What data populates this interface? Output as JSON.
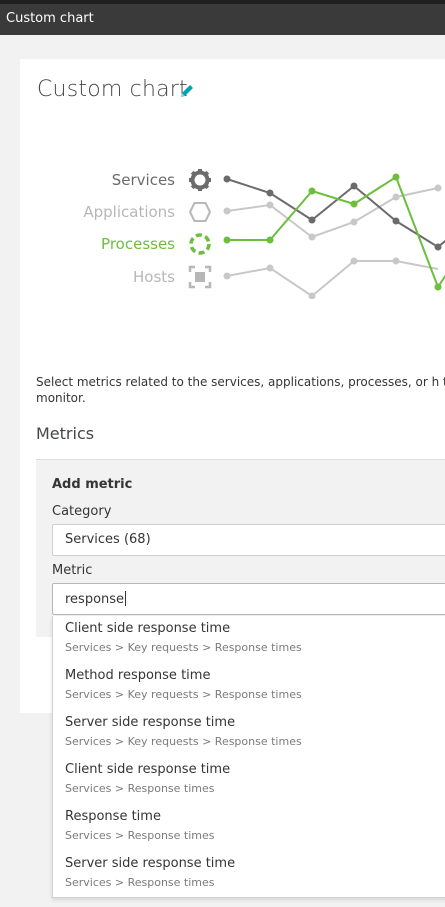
{
  "window": {
    "title": "Custom chart"
  },
  "page": {
    "title": "Custom chart"
  },
  "legend": [
    {
      "label": "Services",
      "color": "#6b6b6b",
      "icon": "gear-icon"
    },
    {
      "label": "Applications",
      "color": "#b7b7b7",
      "icon": "hexagon-icon"
    },
    {
      "label": "Processes",
      "color": "#6bbf3c",
      "icon": "dashed-circle-icon"
    },
    {
      "label": "Hosts",
      "color": "#b7b7b7",
      "icon": "host-square-icon"
    }
  ],
  "description": "Select metrics related to the services, applications, processes, or h to monitor.",
  "metrics_section": {
    "title": "Metrics",
    "add_metric": "Add metric",
    "category_label": "Category",
    "category_value": "Services (68)",
    "metric_label": "Metric",
    "metric_value": "response"
  },
  "suggestions": [
    {
      "name": "Client side response time",
      "path": "Services > Key requests > Response times"
    },
    {
      "name": "Method response time",
      "path": "Services > Key requests > Response times"
    },
    {
      "name": "Server side response time",
      "path": "Services > Key requests > Response times"
    },
    {
      "name": "Client side response time",
      "path": "Services > Response times"
    },
    {
      "name": "Response time",
      "path": "Services > Response times"
    },
    {
      "name": "Server side response time",
      "path": "Services > Response times"
    }
  ],
  "colors": {
    "accent_green": "#6bbf3c",
    "edit_blue": "#00a1b2",
    "dark_gray": "#6b6b6b",
    "light_gray": "#c8c8c8"
  }
}
